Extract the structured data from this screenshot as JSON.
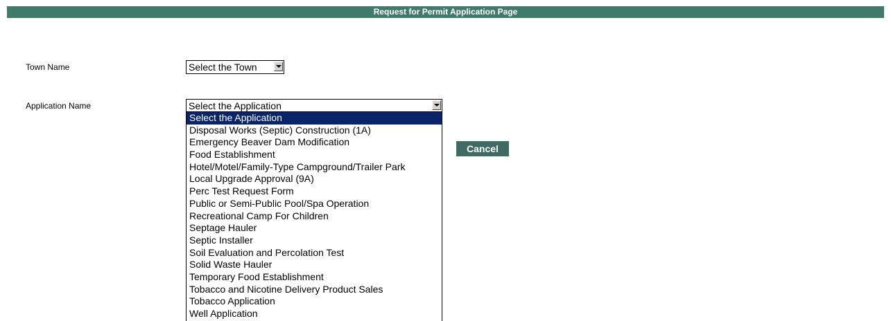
{
  "header": {
    "title": "Request for Permit Application Page"
  },
  "form": {
    "town_label": "Town Name",
    "town_select_value": "Select the Town",
    "application_label": "Application Name",
    "application_select_value": "Select the Application",
    "application_options": [
      "Select the Application",
      "Disposal Works (Septic) Construction (1A)",
      "Emergency Beaver Dam Modification",
      "Food Establishment",
      "Hotel/Motel/Family-Type Campground/Trailer Park",
      "Local Upgrade Approval (9A)",
      "Perc Test Request Form",
      "Public or Semi-Public Pool/Spa Operation",
      "Recreational Camp For Children",
      "Septage Hauler",
      "Septic Installer",
      "Soil Evaluation and Percolation Test",
      "Solid Waste Hauler",
      "Temporary Food Establishment",
      "Tobacco and Nicotine Delivery Product Sales",
      "Tobacco Application",
      "Well Application"
    ],
    "cancel_label": "Cancel"
  },
  "colors": {
    "header_bg": "#3f7a6a",
    "button_bg": "#3f6b63",
    "selected_option_bg": "#0a246a"
  }
}
